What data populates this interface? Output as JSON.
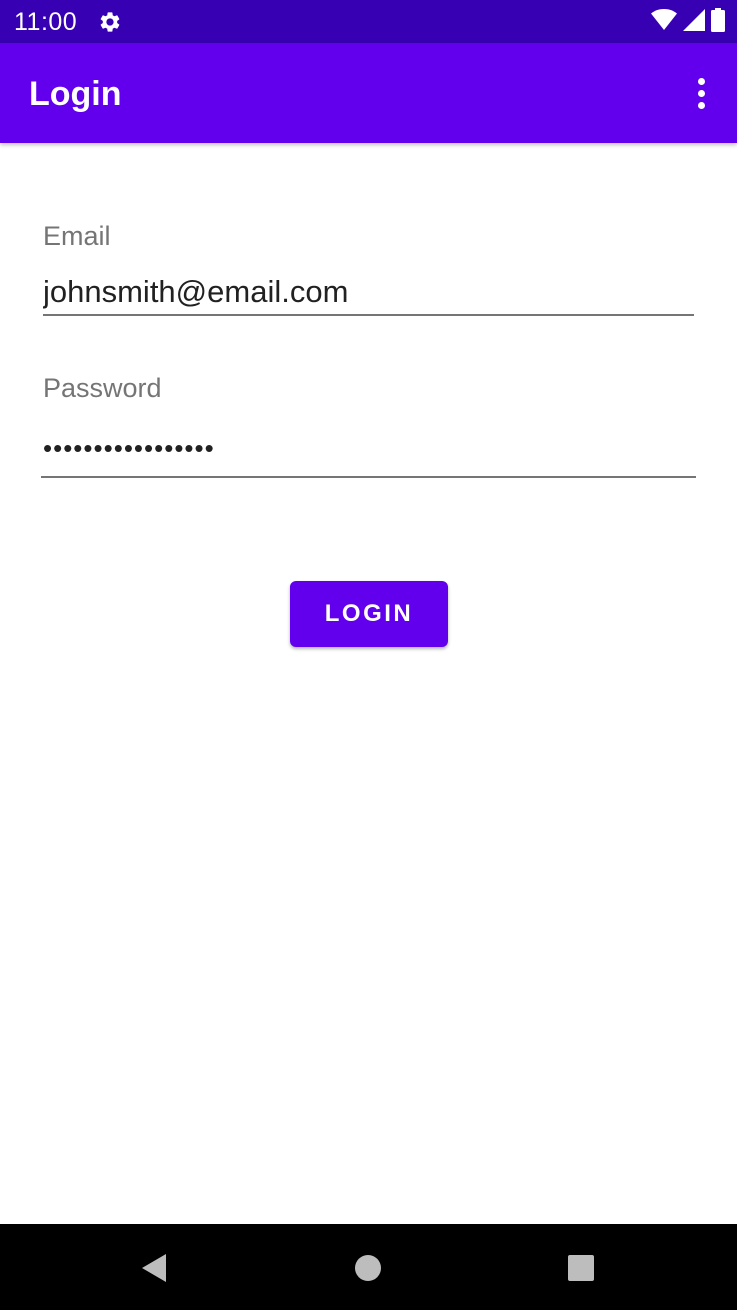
{
  "status_bar": {
    "time": "11:00",
    "icons": [
      "gear-icon",
      "wifi-icon",
      "cellular-signal-icon",
      "battery-icon"
    ],
    "background": "#3700b3"
  },
  "app_bar": {
    "title": "Login",
    "overflow_icon": "more-vert-icon",
    "background": "#6200ee"
  },
  "form": {
    "email": {
      "label": "Email",
      "value": "johnsmith@email.com"
    },
    "password": {
      "label": "Password",
      "value": "•••••••••••••••••"
    },
    "submit_label": "LOGIN",
    "accent": "#6200ee"
  },
  "nav_bar": {
    "buttons": [
      "back-icon",
      "home-icon",
      "recents-icon"
    ],
    "background": "#000000"
  }
}
